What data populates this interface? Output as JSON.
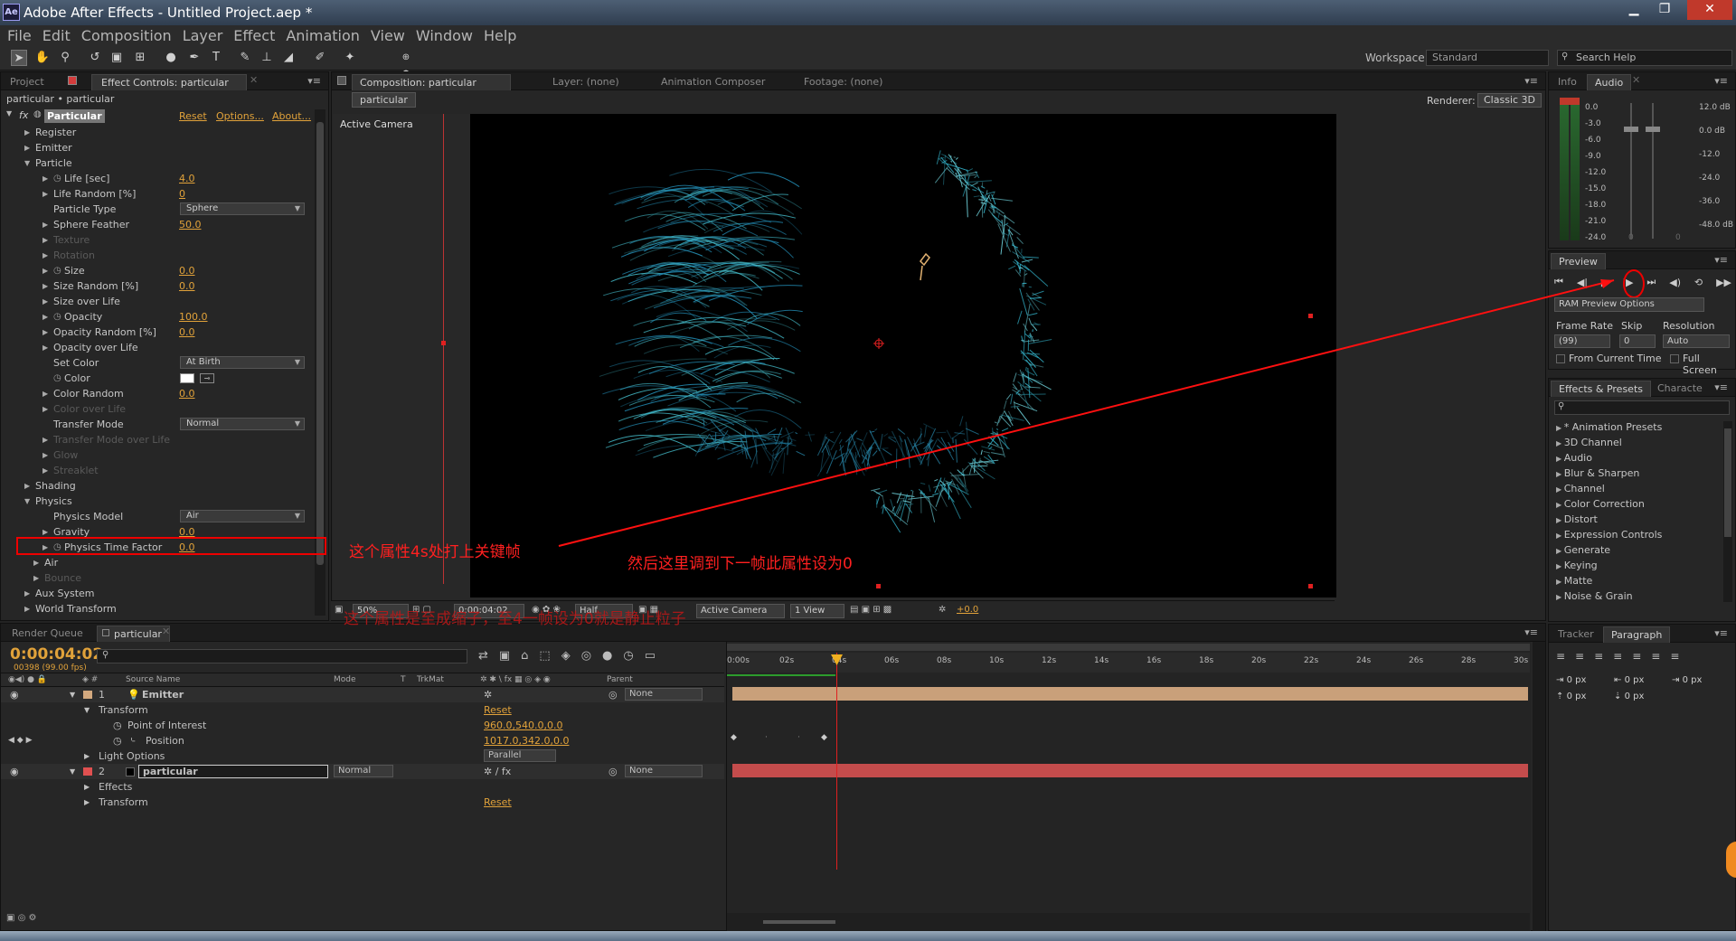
{
  "window": {
    "title": "Adobe After Effects - Untitled Project.aep *",
    "app_icon": "Ae"
  },
  "menu": [
    "File",
    "Edit",
    "Composition",
    "Layer",
    "Effect",
    "Animation",
    "View",
    "Window",
    "Help"
  ],
  "toolbar": {
    "workspace_label": "Workspace:",
    "workspace_value": "Standard",
    "search_placeholder": "Search Help"
  },
  "left_panel": {
    "tabs": [
      "Project",
      "Effect Controls: particular"
    ],
    "breadcrumb": "particular • particular",
    "effect_name": "Particular",
    "reset": "Reset",
    "options": "Options...",
    "about": "About...",
    "rows": [
      {
        "name": "Register",
        "indent": 0,
        "twirl": true
      },
      {
        "name": "Emitter",
        "indent": 0,
        "twirl": true
      },
      {
        "name": "Particle",
        "indent": 0,
        "twirl": true,
        "open": true
      },
      {
        "name": "Life [sec]",
        "indent": 2,
        "twirl": true,
        "stopwatch": true,
        "value": "4.0"
      },
      {
        "name": "Life Random [%]",
        "indent": 2,
        "twirl": true,
        "value": "0"
      },
      {
        "name": "Particle Type",
        "indent": 2,
        "dropdown": "Sphere"
      },
      {
        "name": "Sphere Feather",
        "indent": 2,
        "twirl": true,
        "value": "50.0"
      },
      {
        "name": "Texture",
        "indent": 2,
        "twirl": true,
        "dim": true
      },
      {
        "name": "Rotation",
        "indent": 2,
        "twirl": true,
        "dim": true
      },
      {
        "name": "Size",
        "indent": 2,
        "twirl": true,
        "stopwatch": true,
        "value": "0.0"
      },
      {
        "name": "Size Random [%]",
        "indent": 2,
        "twirl": true,
        "value": "0.0"
      },
      {
        "name": "Size over Life",
        "indent": 2,
        "twirl": true
      },
      {
        "name": "Opacity",
        "indent": 2,
        "twirl": true,
        "stopwatch": true,
        "value": "100.0"
      },
      {
        "name": "Opacity Random [%]",
        "indent": 2,
        "twirl": true,
        "value": "0.0"
      },
      {
        "name": "Opacity over Life",
        "indent": 2,
        "twirl": true
      },
      {
        "name": "Set Color",
        "indent": 2,
        "dropdown": "At Birth"
      },
      {
        "name": "Color",
        "indent": 2,
        "stopwatch": true,
        "color": "#ffffff"
      },
      {
        "name": "Color Random",
        "indent": 2,
        "twirl": true,
        "value": "0.0"
      },
      {
        "name": "Color over Life",
        "indent": 2,
        "twirl": true,
        "dim": true
      },
      {
        "name": "Transfer Mode",
        "indent": 2,
        "dropdown": "Normal"
      },
      {
        "name": "Transfer Mode over Life",
        "indent": 2,
        "twirl": true,
        "dim": true
      },
      {
        "name": "Glow",
        "indent": 2,
        "twirl": true,
        "dim": true
      },
      {
        "name": "Streaklet",
        "indent": 2,
        "twirl": true,
        "dim": true
      },
      {
        "name": "Shading",
        "indent": 0,
        "twirl": true
      },
      {
        "name": "Physics",
        "indent": 0,
        "twirl": true,
        "open": true
      },
      {
        "name": "Physics Model",
        "indent": 2,
        "dropdown": "Air"
      },
      {
        "name": "Gravity",
        "indent": 2,
        "twirl": true,
        "value": "0.0"
      },
      {
        "name": "Physics Time Factor",
        "indent": 2,
        "twirl": true,
        "stopwatch": true,
        "keyed": true,
        "value": "0.0"
      },
      {
        "name": "Air",
        "indent": 1,
        "twirl": true
      },
      {
        "name": "Bounce",
        "indent": 1,
        "twirl": true,
        "dim": true
      },
      {
        "name": "Aux System",
        "indent": 0,
        "twirl": true
      },
      {
        "name": "World Transform",
        "indent": 0,
        "twirl": true
      }
    ]
  },
  "comp_panel": {
    "tabs": [
      "Composition: particular",
      "Layer: (none)",
      "Animation Composer",
      "Footage: (none)"
    ],
    "comp_tab": "particular",
    "renderer_label": "Renderer:",
    "renderer_value": "Classic 3D",
    "camera_label": "Active Camera",
    "footer": {
      "zoom": "50%",
      "timecode": "0:00:04:02",
      "resolution": "Half",
      "view": "Active Camera",
      "views": "1 View",
      "exposure": "+0.0"
    }
  },
  "info_panel": {
    "tabs": [
      "Info",
      "Audio"
    ],
    "db_left": [
      "0.0",
      "-3.0",
      "-6.0",
      "-9.0",
      "-12.0",
      "-15.0",
      "-18.0",
      "-21.0",
      "-24.0"
    ],
    "db_right": [
      "12.0 dB",
      "0.0 dB",
      "-12.0",
      "-24.0",
      "-36.0",
      "-48.0 dB"
    ],
    "knob_values": [
      "0",
      "0"
    ]
  },
  "preview_panel": {
    "title": "Preview",
    "ram_options": "RAM Preview Options",
    "frame_rate_label": "Frame Rate",
    "skip_label": "Skip",
    "resolution_label": "Resolution",
    "frame_rate": "(99)",
    "skip": "0",
    "resolution": "Auto",
    "from_current": "From Current Time",
    "full_screen": "Full Screen"
  },
  "effects_panel": {
    "tabs": [
      "Effects & Presets",
      "Characte"
    ],
    "items": [
      "* Animation Presets",
      "3D Channel",
      "Audio",
      "Blur & Sharpen",
      "Channel",
      "Color Correction",
      "Distort",
      "Expression Controls",
      "Generate",
      "Keying",
      "Matte",
      "Noise & Grain"
    ]
  },
  "paragraph_panel": {
    "tabs": [
      "Tracker",
      "Paragraph"
    ],
    "px": [
      "0 px",
      "0 px",
      "0 px",
      "0 px",
      "0 px"
    ]
  },
  "timeline": {
    "tabs": [
      "Render Queue",
      "particular"
    ],
    "timecode": "0:00:04:02",
    "frames": "00398 (99.00 fps)",
    "columns": {
      "source": "Source Name",
      "mode": "Mode",
      "t": "T",
      "trkmat": "TrkMat",
      "parent": "Parent"
    },
    "ruler": [
      "0:00s",
      "02s",
      "04s",
      "06s",
      "08s",
      "10s",
      "12s",
      "14s",
      "16s",
      "18s",
      "20s",
      "22s",
      "24s",
      "26s",
      "28s",
      "30s"
    ],
    "layers": [
      {
        "num": "1",
        "name": "Emitter",
        "color": "#d3a97f",
        "parent": "None"
      },
      {
        "num": "2",
        "name": "particular",
        "color": "#e05050",
        "mode": "Normal",
        "parent": "None"
      }
    ],
    "props": {
      "transform": "Transform",
      "reset": "Reset",
      "poi": "Point of Interest",
      "poi_val": "960.0,540.0,0.0",
      "position": "Position",
      "position_val": "1017.0,342.0,0.0",
      "light_options": "Light Options",
      "light_val": "Parallel",
      "effects": "Effects",
      "transform2": "Transform",
      "reset2": "Reset"
    }
  },
  "annotations": {
    "a1": "这个属性4s处打上关键帧",
    "a2": "然后这里调到下一帧此属性设为0",
    "a3": "这个属性是至成缩子，至4一帧设为0就是静止粒子"
  },
  "colors": {
    "accent": "#e1a23a",
    "annotation": "#ff2020",
    "particle": "#3cc8e0"
  }
}
